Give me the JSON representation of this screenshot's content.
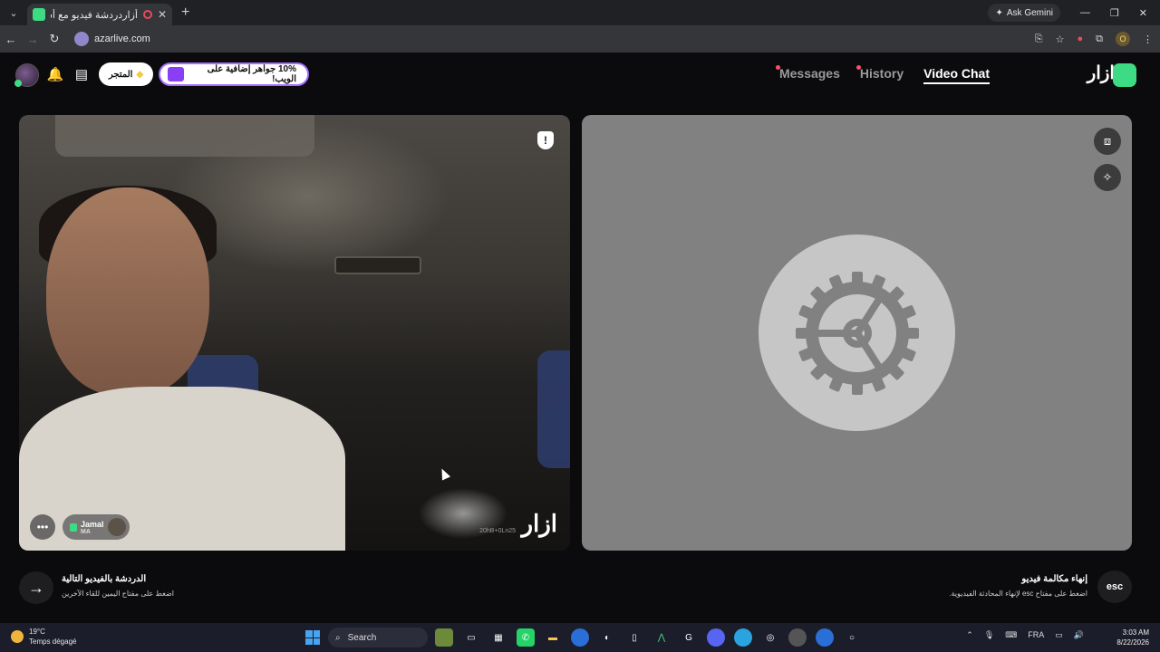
{
  "browser": {
    "tab_title": "أزاردردشة فيديو مع أشخاص",
    "url": "azarlive.com",
    "ask_gemini": "Ask Gemini",
    "profile_initial": "O"
  },
  "header": {
    "store_label": "المتجر",
    "promo_label": "10% جواهر إضافية على الويب!",
    "nav": [
      "Messages",
      "History",
      "Video Chat"
    ],
    "logo": "ازار"
  },
  "left_video": {
    "user_name": "Jamal",
    "country": "MA",
    "watermark_id": "20hB+0Ln25",
    "watermark_logo": "ازار"
  },
  "bottom": {
    "next_title": "الدردشة بالفيديو التالية",
    "next_sub": "اضغط على مفتاح اليمين للقاء الآخرين",
    "end_title": "إنهاء مكالمة فيديو",
    "end_sub": "اضغط على مفتاح esc لإنهاء المحادثة الفيديوية.",
    "esc_label": "esc"
  },
  "taskbar": {
    "temp": "19°C",
    "weather": "Temps dégagé",
    "search": "Search",
    "lang": "FRA",
    "time": "3:03 AM",
    "date": "8/22/2026"
  },
  "colors": {
    "accent": "#3ddc84",
    "promo_border": "#a46dff",
    "dot": "#ff4f6d"
  }
}
